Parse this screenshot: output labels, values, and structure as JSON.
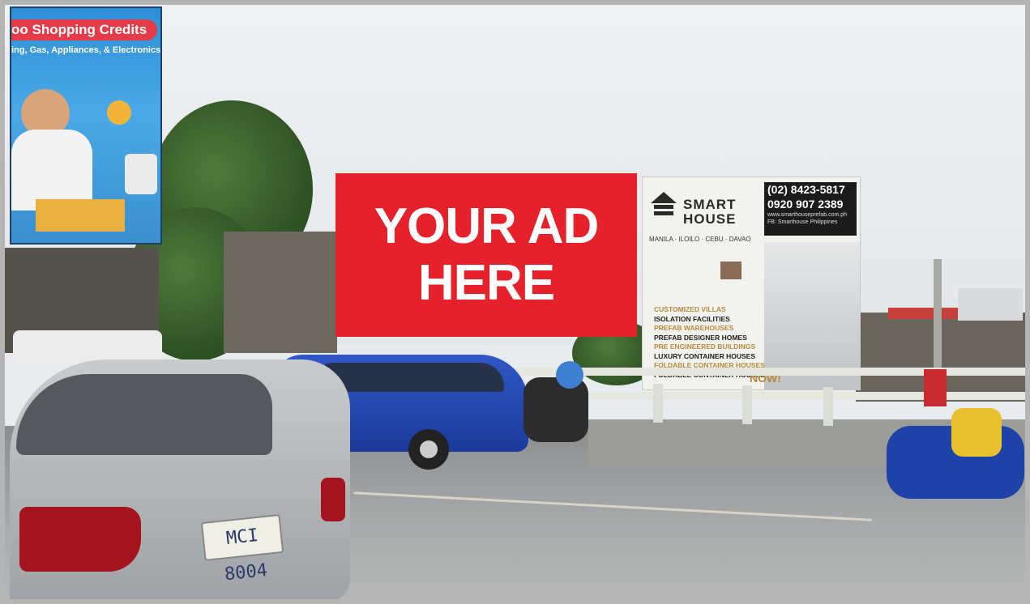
{
  "ad_board": {
    "line1": "YOUR AD",
    "line2": "HERE",
    "color": "#e5222b"
  },
  "digital_screen": {
    "title": "oo Shopping Credits",
    "subtitle": "ing, Gas, Appliances, & Electronics"
  },
  "smarthouse_billboard": {
    "brand_line1": "SMART",
    "brand_line2": "HOUSE",
    "phone1": "(02) 8423-5817",
    "phone2": "0920 907 2389",
    "website": "www.smarthouseprefab.com.ph",
    "facebook": "FB: Smarthouse Philippines",
    "cities": "MANILA · ILOILO · CEBU · DAVAO",
    "services": [
      "CUSTOMIZED VILLAS",
      "ISOLATION FACILITIES",
      "PREFAB WAREHOUSES",
      "PREFAB DESIGNER HOMES",
      "PRE ENGINEERED BUILDINGS",
      "LUXURY CONTAINER HOUSES",
      "FOLDABLE CONTAINER HOUSES",
      "FOLDABLE CONTAINER HOUSES"
    ],
    "cta": "NOW!"
  },
  "car_plate": "MCI 8004"
}
